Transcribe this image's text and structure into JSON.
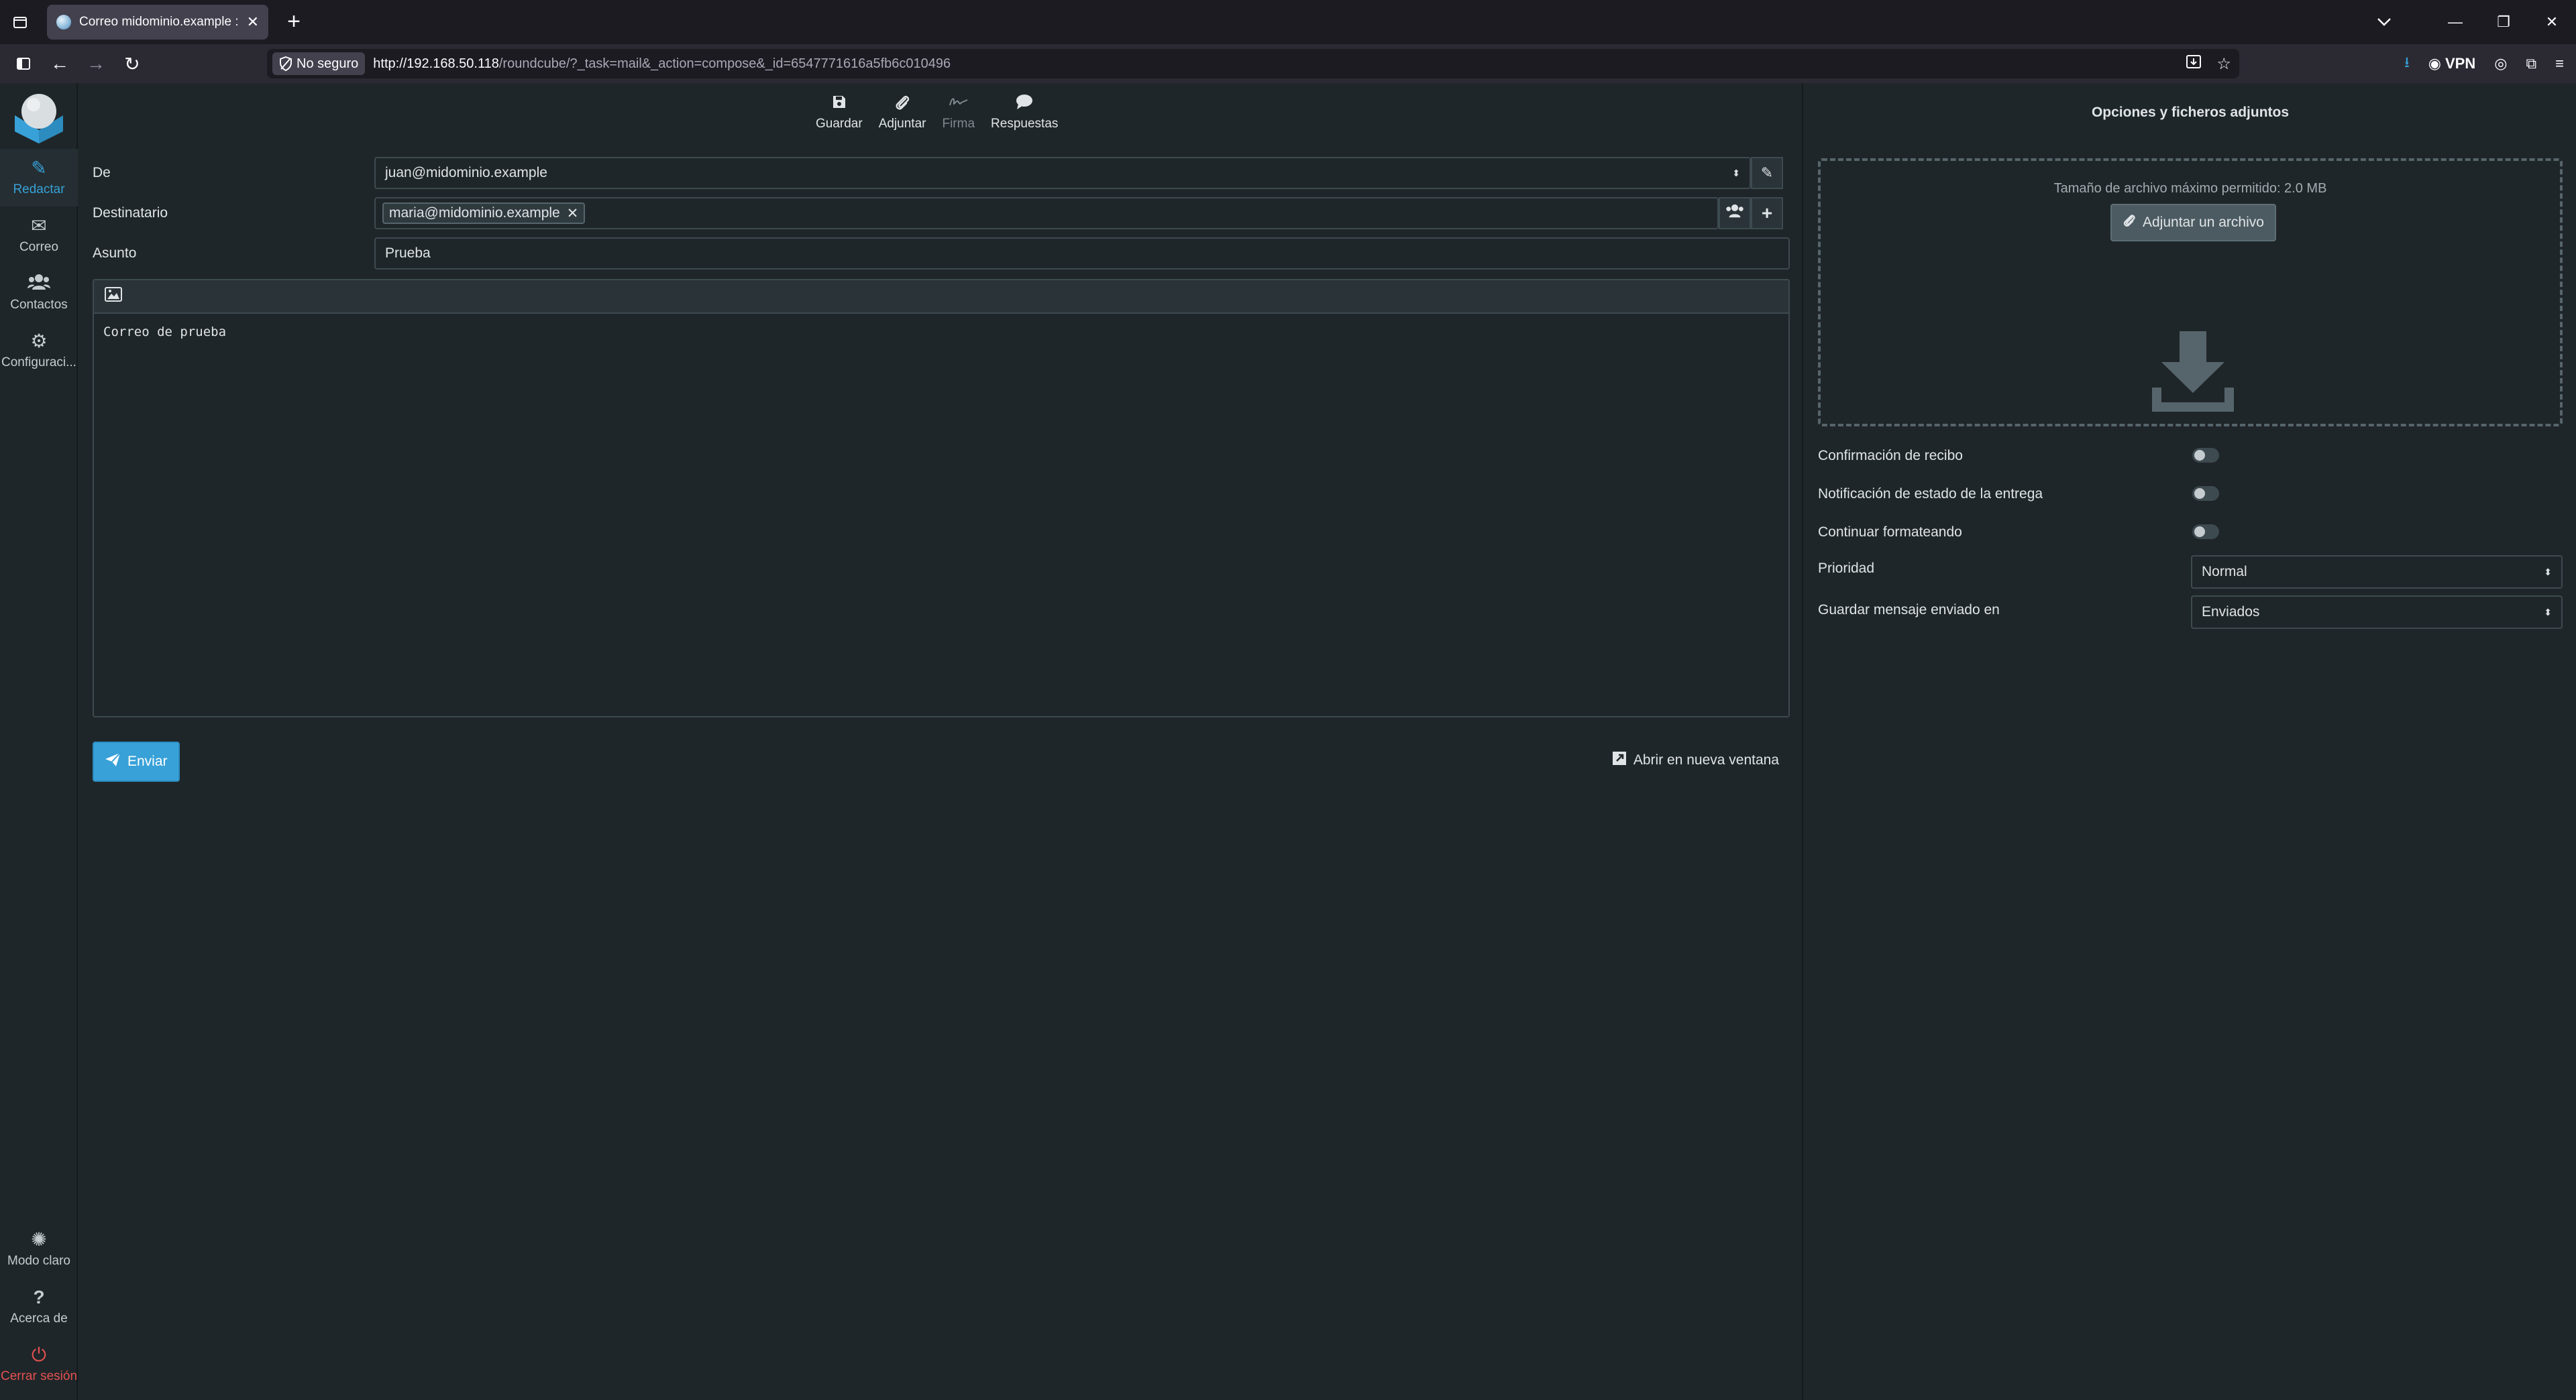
{
  "browser": {
    "tab_title": "Correo midominio.example :: Ro",
    "not_secure_label": "No seguro",
    "url_host": "http://192.168.50.118",
    "url_path": "/roundcube/?_task=mail&_action=compose&_id=6547771616a5fb6c010496",
    "vpn_label": "VPN"
  },
  "sidebar": {
    "compose": "Redactar",
    "mail": "Correo",
    "contacts": "Contactos",
    "settings": "Configuraci...",
    "light_mode": "Modo claro",
    "about": "Acerca de",
    "logout": "Cerrar sesión"
  },
  "toolbar": {
    "save": "Guardar",
    "attach": "Adjuntar",
    "signature": "Firma",
    "responses": "Respuestas"
  },
  "form": {
    "from_label": "De",
    "from_value": "juan@midominio.example",
    "to_label": "Destinatario",
    "to_recipient": "maria@midominio.example",
    "subject_label": "Asunto",
    "subject_value": "Prueba",
    "body": "Correo de prueba"
  },
  "actions": {
    "send": "Enviar",
    "open_new_window": "Abrir en nueva ventana"
  },
  "options": {
    "title": "Opciones y ficheros adjuntos",
    "max_size": "Tamaño de archivo máximo permitido: 2.0 MB",
    "attach_file": "Adjuntar un archivo",
    "read_receipt": "Confirmación de recibo",
    "delivery_status": "Notificación de estado de la entrega",
    "keep_formatting": "Continuar formateando",
    "priority_label": "Prioridad",
    "priority_value": "Normal",
    "save_sent_label": "Guardar mensaje enviado en",
    "save_sent_value": "Enviados"
  },
  "colors": {
    "accent": "#37a1d8",
    "background": "#1f2629",
    "danger": "#e55151"
  },
  "icons": {
    "save": "floppy-icon",
    "attach": "paperclip-icon",
    "signature": "signature-icon",
    "responses": "speech-bubble-icon",
    "upload": "download-arrow-icon"
  }
}
